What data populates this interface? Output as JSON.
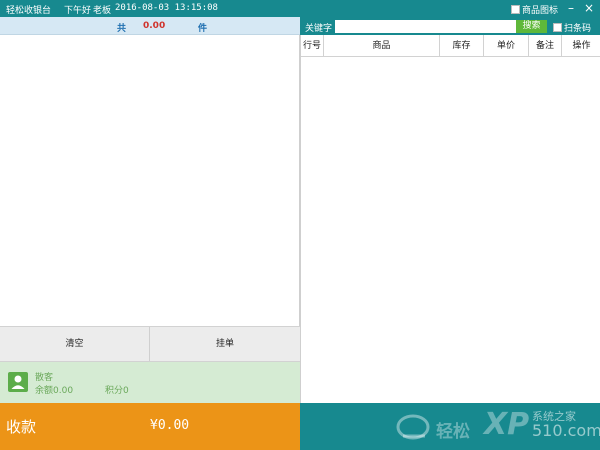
{
  "titlebar": {
    "app_name": "轻松收银台",
    "greeting": "下午好",
    "user": "老板",
    "datetime": "2016-08-03 13:15:08",
    "product_icon_label": "商品图标",
    "minimize": "–",
    "close": "×"
  },
  "summary": {
    "prefix": "共",
    "amount": "0.00",
    "suffix": "件"
  },
  "actions": {
    "clear": "清空",
    "hold": "挂单"
  },
  "member": {
    "name": "散客",
    "balance": "余额0.00",
    "points": "积分0"
  },
  "checkout": {
    "label": "收款",
    "total": "¥0.00"
  },
  "search": {
    "keyword_label": "关键字",
    "value": "",
    "button": "搜索",
    "barcode_label": "扫条码"
  },
  "table": {
    "columns": [
      "行号",
      "商品",
      "库存",
      "单价",
      "备注",
      "操作"
    ],
    "rows": []
  },
  "watermark": {
    "brand": "轻松",
    "x_mark": "XP",
    "site_name": "系统之家",
    "site_url": "510.com"
  },
  "colors": {
    "titlebar": "#17898f",
    "checkout": "#ec9417",
    "member_bg": "#d5ebd3",
    "search_button": "#5fb83a",
    "amount_red": "#d0332b"
  }
}
